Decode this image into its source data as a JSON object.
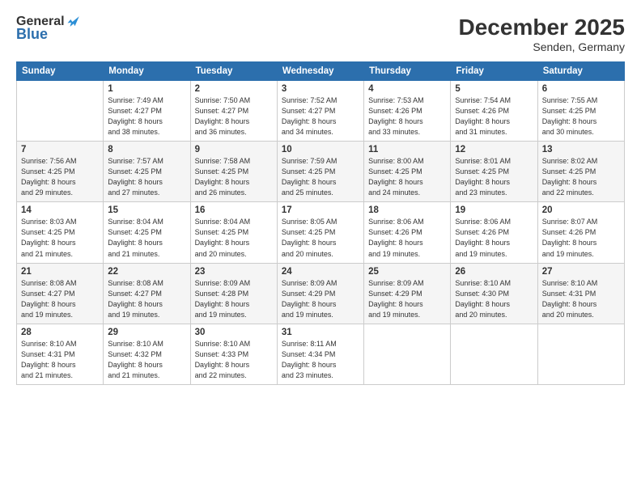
{
  "header": {
    "logo_general": "General",
    "logo_blue": "Blue",
    "month_title": "December 2025",
    "location": "Senden, Germany"
  },
  "days_of_week": [
    "Sunday",
    "Monday",
    "Tuesday",
    "Wednesday",
    "Thursday",
    "Friday",
    "Saturday"
  ],
  "weeks": [
    [
      {
        "day": "",
        "info": ""
      },
      {
        "day": "1",
        "info": "Sunrise: 7:49 AM\nSunset: 4:27 PM\nDaylight: 8 hours\nand 38 minutes."
      },
      {
        "day": "2",
        "info": "Sunrise: 7:50 AM\nSunset: 4:27 PM\nDaylight: 8 hours\nand 36 minutes."
      },
      {
        "day": "3",
        "info": "Sunrise: 7:52 AM\nSunset: 4:27 PM\nDaylight: 8 hours\nand 34 minutes."
      },
      {
        "day": "4",
        "info": "Sunrise: 7:53 AM\nSunset: 4:26 PM\nDaylight: 8 hours\nand 33 minutes."
      },
      {
        "day": "5",
        "info": "Sunrise: 7:54 AM\nSunset: 4:26 PM\nDaylight: 8 hours\nand 31 minutes."
      },
      {
        "day": "6",
        "info": "Sunrise: 7:55 AM\nSunset: 4:25 PM\nDaylight: 8 hours\nand 30 minutes."
      }
    ],
    [
      {
        "day": "7",
        "info": "Sunrise: 7:56 AM\nSunset: 4:25 PM\nDaylight: 8 hours\nand 29 minutes."
      },
      {
        "day": "8",
        "info": "Sunrise: 7:57 AM\nSunset: 4:25 PM\nDaylight: 8 hours\nand 27 minutes."
      },
      {
        "day": "9",
        "info": "Sunrise: 7:58 AM\nSunset: 4:25 PM\nDaylight: 8 hours\nand 26 minutes."
      },
      {
        "day": "10",
        "info": "Sunrise: 7:59 AM\nSunset: 4:25 PM\nDaylight: 8 hours\nand 25 minutes."
      },
      {
        "day": "11",
        "info": "Sunrise: 8:00 AM\nSunset: 4:25 PM\nDaylight: 8 hours\nand 24 minutes."
      },
      {
        "day": "12",
        "info": "Sunrise: 8:01 AM\nSunset: 4:25 PM\nDaylight: 8 hours\nand 23 minutes."
      },
      {
        "day": "13",
        "info": "Sunrise: 8:02 AM\nSunset: 4:25 PM\nDaylight: 8 hours\nand 22 minutes."
      }
    ],
    [
      {
        "day": "14",
        "info": "Sunrise: 8:03 AM\nSunset: 4:25 PM\nDaylight: 8 hours\nand 21 minutes."
      },
      {
        "day": "15",
        "info": "Sunrise: 8:04 AM\nSunset: 4:25 PM\nDaylight: 8 hours\nand 21 minutes."
      },
      {
        "day": "16",
        "info": "Sunrise: 8:04 AM\nSunset: 4:25 PM\nDaylight: 8 hours\nand 20 minutes."
      },
      {
        "day": "17",
        "info": "Sunrise: 8:05 AM\nSunset: 4:25 PM\nDaylight: 8 hours\nand 20 minutes."
      },
      {
        "day": "18",
        "info": "Sunrise: 8:06 AM\nSunset: 4:26 PM\nDaylight: 8 hours\nand 19 minutes."
      },
      {
        "day": "19",
        "info": "Sunrise: 8:06 AM\nSunset: 4:26 PM\nDaylight: 8 hours\nand 19 minutes."
      },
      {
        "day": "20",
        "info": "Sunrise: 8:07 AM\nSunset: 4:26 PM\nDaylight: 8 hours\nand 19 minutes."
      }
    ],
    [
      {
        "day": "21",
        "info": "Sunrise: 8:08 AM\nSunset: 4:27 PM\nDaylight: 8 hours\nand 19 minutes."
      },
      {
        "day": "22",
        "info": "Sunrise: 8:08 AM\nSunset: 4:27 PM\nDaylight: 8 hours\nand 19 minutes."
      },
      {
        "day": "23",
        "info": "Sunrise: 8:09 AM\nSunset: 4:28 PM\nDaylight: 8 hours\nand 19 minutes."
      },
      {
        "day": "24",
        "info": "Sunrise: 8:09 AM\nSunset: 4:29 PM\nDaylight: 8 hours\nand 19 minutes."
      },
      {
        "day": "25",
        "info": "Sunrise: 8:09 AM\nSunset: 4:29 PM\nDaylight: 8 hours\nand 19 minutes."
      },
      {
        "day": "26",
        "info": "Sunrise: 8:10 AM\nSunset: 4:30 PM\nDaylight: 8 hours\nand 20 minutes."
      },
      {
        "day": "27",
        "info": "Sunrise: 8:10 AM\nSunset: 4:31 PM\nDaylight: 8 hours\nand 20 minutes."
      }
    ],
    [
      {
        "day": "28",
        "info": "Sunrise: 8:10 AM\nSunset: 4:31 PM\nDaylight: 8 hours\nand 21 minutes."
      },
      {
        "day": "29",
        "info": "Sunrise: 8:10 AM\nSunset: 4:32 PM\nDaylight: 8 hours\nand 21 minutes."
      },
      {
        "day": "30",
        "info": "Sunrise: 8:10 AM\nSunset: 4:33 PM\nDaylight: 8 hours\nand 22 minutes."
      },
      {
        "day": "31",
        "info": "Sunrise: 8:11 AM\nSunset: 4:34 PM\nDaylight: 8 hours\nand 23 minutes."
      },
      {
        "day": "",
        "info": ""
      },
      {
        "day": "",
        "info": ""
      },
      {
        "day": "",
        "info": ""
      }
    ]
  ]
}
